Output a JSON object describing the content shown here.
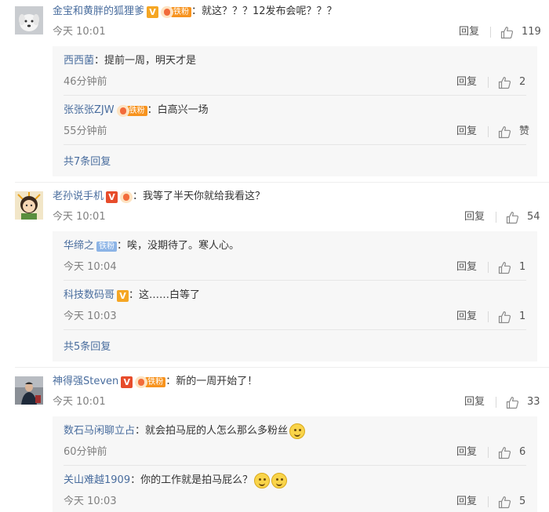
{
  "comments": [
    {
      "username": "金宝和黄胖的狐狸爹",
      "badge_fan": "铁粉",
      "text": "：就这？？？12发布会呢？？？",
      "time": "今天 10:01",
      "reply_label": "回复",
      "likes": "119",
      "replies": [
        {
          "username": "西西菌",
          "text": "：提前一周，明天才是",
          "time": "46分钟前",
          "reply_label": "回复",
          "likes": "2"
        },
        {
          "username": "张张张ZJW",
          "badge_fan": "铁粉",
          "text": "：白高兴一场",
          "time": "55分钟前",
          "reply_label": "回复",
          "likes": "赞"
        }
      ],
      "more_label": "共7条回复"
    },
    {
      "username": "老孙说手机",
      "text": "：我等了半天你就给我看这？",
      "time": "今天 10:01",
      "reply_label": "回复",
      "likes": "54",
      "replies": [
        {
          "username": "华缔之",
          "badge_fan": "铁粉",
          "text": "：唉，没期待了。寒人心。",
          "time": "今天 10:04",
          "reply_label": "回复",
          "likes": "1"
        },
        {
          "username": "科技数码哥",
          "text": "：这……白等了",
          "time": "今天 10:03",
          "reply_label": "回复",
          "likes": "1"
        }
      ],
      "more_label": "共5条回复"
    },
    {
      "username": "神得强Steven",
      "badge_fan": "铁粉",
      "text": "：新的一周开始了！",
      "time": "今天 10:01",
      "reply_label": "回复",
      "likes": "33",
      "replies": [
        {
          "username": "数石马闲聊立占",
          "text": "：就会拍马屁的人怎么那么多粉丝",
          "time": "60分钟前",
          "reply_label": "回复",
          "likes": "6"
        },
        {
          "username": "关山难越1909",
          "text": "：你的工作就是拍马屁么？",
          "time": "今天 10:03",
          "reply_label": "回复",
          "likes": "5"
        }
      ]
    }
  ],
  "colors": {
    "username": "#496d9e",
    "text": "#333333",
    "meta": "#808080",
    "subbox_bg": "#f7f7f7"
  },
  "icons": {
    "thumb": "thumbs-up-icon",
    "verified": "verified-v-icon",
    "fan": "fan-badge-icon",
    "emoji": "smiley-emoji-icon"
  }
}
